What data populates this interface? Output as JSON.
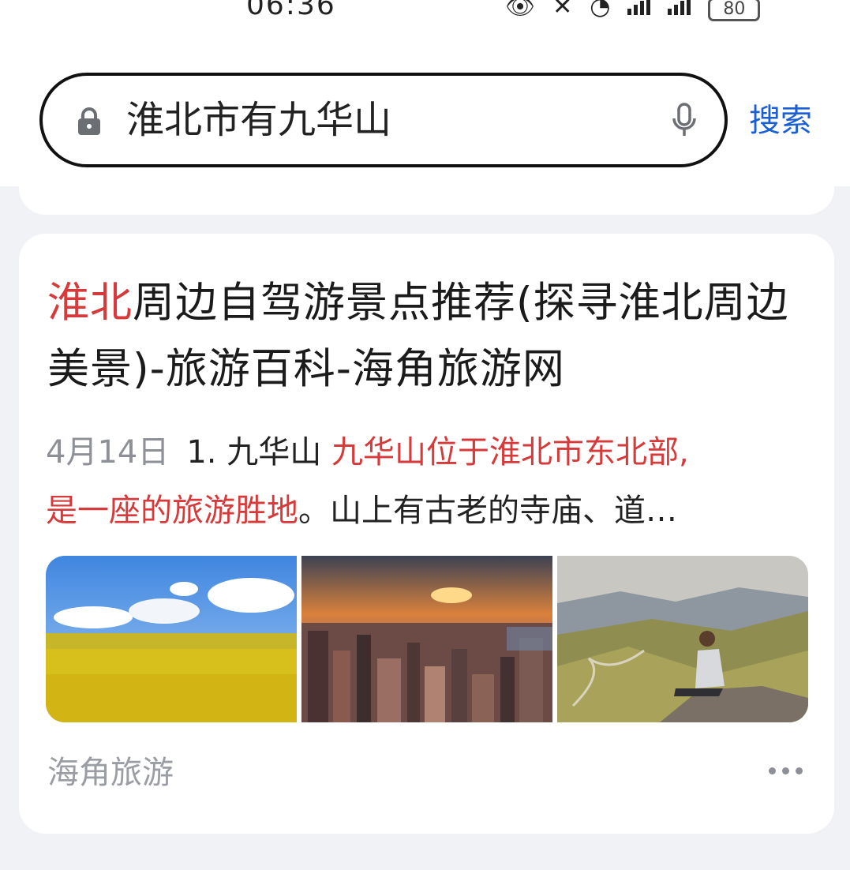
{
  "status_bar": {
    "time": "06:36",
    "battery": "80"
  },
  "search": {
    "query": "淮北市有九华山",
    "submit_label": "搜索"
  },
  "result": {
    "title_highlight": "淮北",
    "title_rest": "周边自驾游景点推荐(探寻淮北周边美景)-旅游百科-海角旅游网",
    "date": "4月14日",
    "snippet_prefix": "1. 九华山 ",
    "snippet_highlight": "九华山位于淮北市东北部,",
    "snippet_highlight_2": "是一座的旅游胜地",
    "snippet_suffix": "。山上有古老的寺庙、道…",
    "images": [
      "rapeseed-field-image",
      "city-sunset-image",
      "mountain-valley-image"
    ],
    "source": "海角旅游"
  },
  "colors": {
    "accent_blue": "#1a5fd6",
    "highlight_red": "#d63a3a",
    "background": "#f1f2f6"
  }
}
